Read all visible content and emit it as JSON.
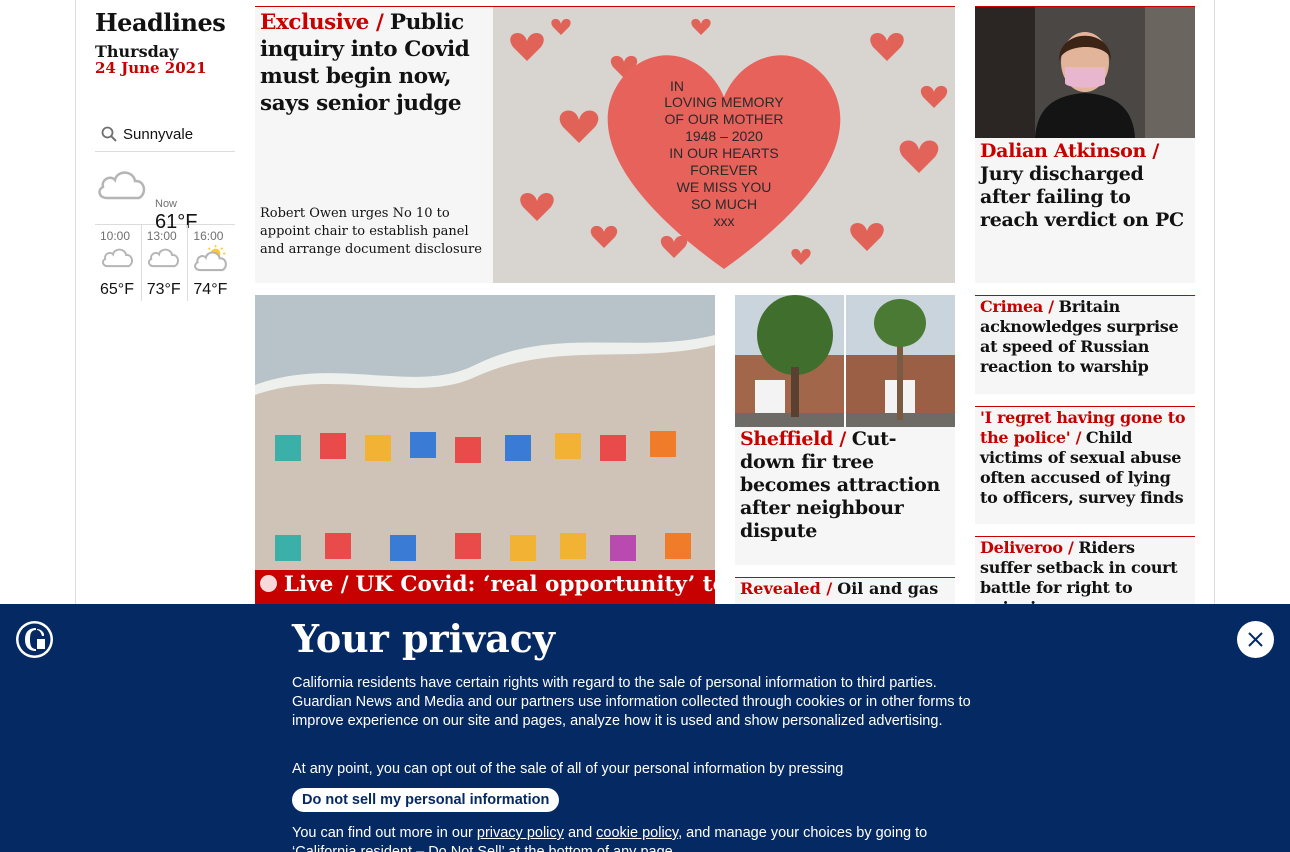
{
  "left": {
    "title": "Headlines",
    "day": "Thursday",
    "date": "24 June 2021"
  },
  "weather": {
    "location": "Sunnyvale",
    "now_label": "Now",
    "now_temp": "61°F",
    "forecast": [
      {
        "time": "10:00",
        "temp": "65°F",
        "icon": "cloud-icon"
      },
      {
        "time": "13:00",
        "temp": "73°F",
        "icon": "cloud-icon"
      },
      {
        "time": "16:00",
        "temp": "74°F",
        "icon": "sun-cloud-icon"
      }
    ]
  },
  "stories": {
    "main": {
      "kicker": "Exclusive /",
      "headline": "Public inquiry into Covid must begin now, says senior judge",
      "standfirst": "Robert Owen urges No 10 to appoint chair to establish panel and arrange document disclosure",
      "image_text": [
        "IN",
        "LOVING MEMORY",
        "OF OUR MOTHER",
        "1948 – 2020",
        "IN OUR HEARTS",
        "FOREVER",
        "WE MISS YOU",
        "SO MUCH",
        "xxx"
      ]
    },
    "atkinson": {
      "kicker": "Dalian Atkinson /",
      "headline": "Jury discharged after failing to reach verdict on PC"
    },
    "crimea": {
      "kicker": "Crimea /",
      "headline": "Britain acknowledges surprise at speed of Russian reaction to warship"
    },
    "regret": {
      "kicker": "'I regret having gone to the police' /",
      "headline": "Child victims of sexual abuse often accused of lying to officers, survey finds"
    },
    "deliveroo": {
      "kicker": "Deliveroo /",
      "headline": "Riders suffer setback in court battle for right to unionise"
    },
    "sheffield": {
      "kicker": "Sheffield /",
      "headline": "Cut-down fir tree becomes attraction after neighbour dispute"
    },
    "live": {
      "kicker": "Live /",
      "headline": "UK Covid: ‘real opportunity’ to"
    },
    "revealed": {
      "kicker": "Revealed /",
      "headline": "Oil and gas"
    }
  },
  "privacy": {
    "title": "Your privacy",
    "body": "California residents have certain rights with regard to the sale of personal information to third parties. Guardian News and Media and our partners use information collected through cookies or in other forms to improve experience on our site and pages, analyze how it is used and show personalized advertising.",
    "optout": "At any point, you can opt out of the sale of all of your personal information by pressing",
    "button": "Do not sell my personal information",
    "more_prefix": "You can find out more in our",
    "privacy_link": "privacy policy",
    "and": "and",
    "cookie_link": "cookie policy",
    "more_suffix": ", and manage your choices by going to ‘California resident – Do Not Sell’ at the bottom of any page."
  },
  "colors": {
    "brand_navy": "#052962",
    "news_red": "#c70000"
  }
}
